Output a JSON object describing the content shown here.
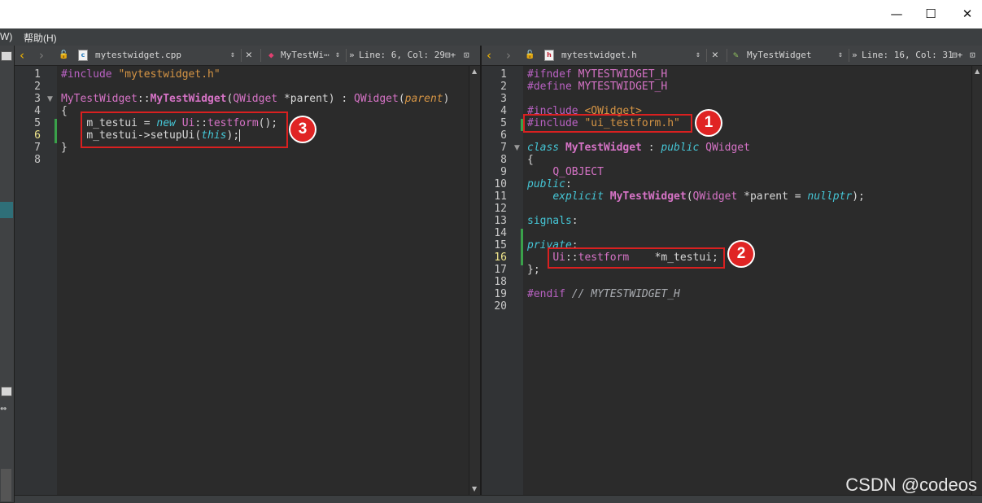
{
  "window": {
    "minimize": "—",
    "maximize": "☐",
    "close": "✕"
  },
  "menubar": {
    "items": [
      "W)",
      "帮助(H)"
    ]
  },
  "left_editor": {
    "filename": "mytestwidget.cpp",
    "file_icon_letter": "c",
    "symbol": "MyTestWi⋯",
    "position": "Line: 6, Col: 29",
    "line_numbers": [
      "1",
      "2",
      "3",
      "4",
      "5",
      "6",
      "7",
      "8"
    ],
    "current_line": "6"
  },
  "right_editor": {
    "filename": "mytestwidget.h",
    "file_icon_letter": "h",
    "symbol": "MyTestWidget",
    "position": "Line: 16, Col: 31",
    "line_numbers": [
      "1",
      "2",
      "3",
      "4",
      "5",
      "6",
      "7",
      "8",
      "9",
      "10",
      "11",
      "12",
      "13",
      "14",
      "15",
      "16",
      "17",
      "18",
      "19",
      "20"
    ],
    "current_line": "16"
  },
  "annotations": {
    "badge_1": "1",
    "badge_2": "2",
    "badge_3": "3"
  },
  "watermark": "CSDN @codeos",
  "colors": {
    "annotation_red": "#d92020",
    "editor_bg": "#2b2b2b",
    "toolbar_bg": "#404244",
    "modified_marker": "#3aa14a"
  }
}
